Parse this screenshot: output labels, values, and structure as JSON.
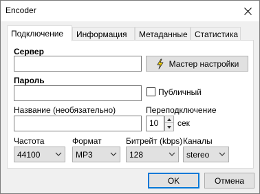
{
  "window": {
    "title": "Encoder"
  },
  "tabs": [
    {
      "label": "Подключение",
      "active": true
    },
    {
      "label": "Информация"
    },
    {
      "label": "Метаданные"
    },
    {
      "label": "Статистика"
    }
  ],
  "form": {
    "server_label": "Сервер",
    "wizard_button": "Мастер настройки",
    "password_label": "Пароль",
    "public_label": "Публичный",
    "name_label": "Название (необязательно)",
    "reconnect_label": "Переподключение",
    "reconnect_value": "10",
    "reconnect_unit": "сек",
    "frequency_label": "Частота",
    "frequency_value": "44100",
    "format_label": "Формат",
    "format_value": "MP3",
    "bitrate_label": "Битрейт (kbps)",
    "bitrate_value": "128",
    "channels_label": "Каналы",
    "channels_value": "stereo"
  },
  "footer": {
    "ok_label": "OK",
    "cancel_label": "Отмена"
  }
}
